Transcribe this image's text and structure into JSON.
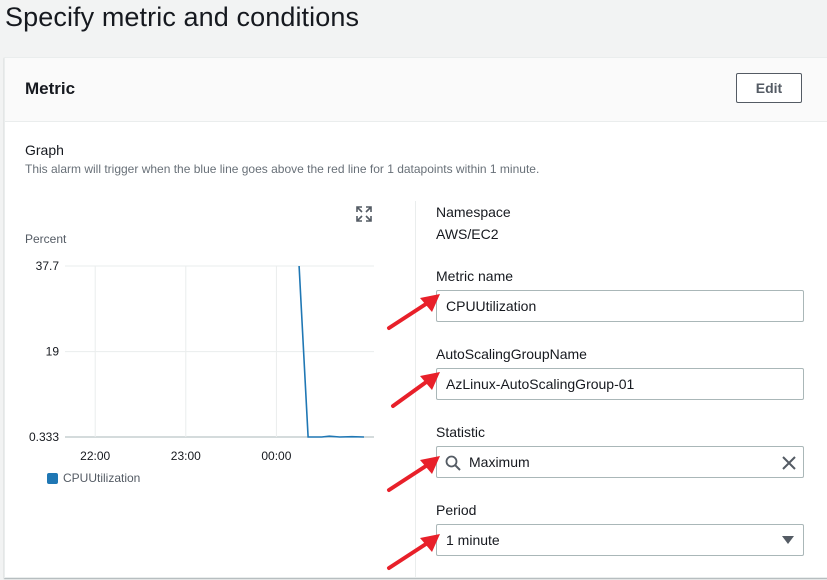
{
  "page": {
    "title": "Specify metric and conditions"
  },
  "metric_panel": {
    "title": "Metric",
    "edit_label": "Edit",
    "graph": {
      "title": "Graph",
      "description": "This alarm will trigger when the blue line goes above the red line for 1 datapoints within 1 minute."
    },
    "fields": {
      "namespace": {
        "label": "Namespace",
        "value": "AWS/EC2"
      },
      "metric_name": {
        "label": "Metric name",
        "value": "CPUUtilization"
      },
      "asg_name": {
        "label": "AutoScalingGroupName",
        "value": "AzLinux-AutoScalingGroup-01"
      },
      "statistic": {
        "label": "Statistic",
        "value": "Maximum"
      },
      "period": {
        "label": "Period",
        "value": "1 minute"
      }
    }
  },
  "annotation": {
    "arrow_color": "#e8202a"
  },
  "chart_data": {
    "type": "line",
    "ylabel": "Percent",
    "y_ticks": [
      "37.7",
      "19",
      "0.333"
    ],
    "x_ticks": [
      "22:00",
      "23:00",
      "00:00"
    ],
    "ylim": [
      0.333,
      37.7
    ],
    "series": [
      {
        "name": "CPUUtilization",
        "color": "#1f77b4",
        "points": [
          [
            "00:15",
            37.7
          ],
          [
            "00:21",
            0.333
          ],
          [
            "00:30",
            0.333
          ],
          [
            "00:35",
            0.5
          ],
          [
            "00:42",
            0.333
          ],
          [
            "00:50",
            0.4
          ],
          [
            "00:58",
            0.333
          ]
        ]
      }
    ]
  }
}
